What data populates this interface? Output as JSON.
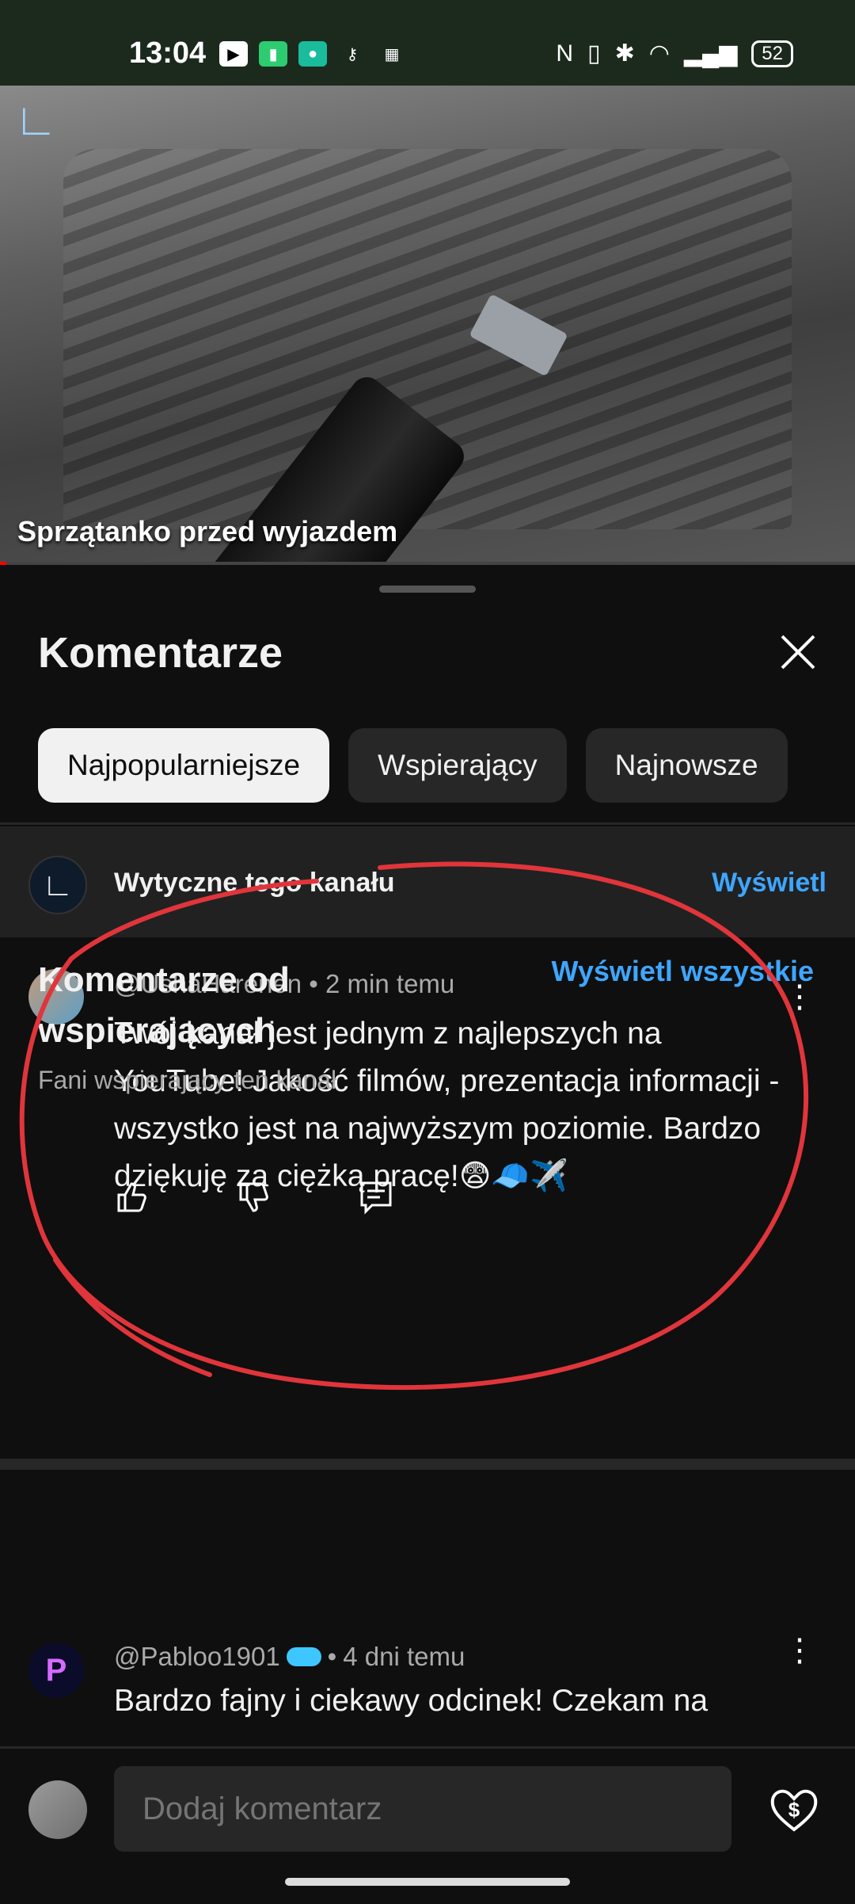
{
  "status_bar": {
    "time": "13:04",
    "battery": "52",
    "icons": [
      "youtube-icon",
      "battery-saver-icon",
      "chat-icon",
      "keyhole-icon",
      "calendar-icon",
      "nfc-icon",
      "vibrate-icon",
      "bluetooth-icon",
      "wifi-icon",
      "signal-icon"
    ]
  },
  "video": {
    "title": "Sprzątanko przed wyjazdem"
  },
  "sheet": {
    "title": "Komentarze",
    "chips": [
      {
        "label": "Najpopularniejsze",
        "active": true
      },
      {
        "label": "Wspierający",
        "active": false
      },
      {
        "label": "Najnowsze",
        "active": false
      }
    ]
  },
  "guidelines": {
    "text": "Wytyczne tego kanału",
    "link": "Wyświetl"
  },
  "comments": [
    {
      "author": "@UshaHarenen",
      "time": "2 min temu",
      "text": "Twój kanał jest jednym z najlepszych na YouTube! Jakość filmów, prezentacja informacji - wszystko jest na najwyższym poziomie. Bardzo dziękuję za ciężką pracę!😨🧢✈️"
    }
  ],
  "supporters": {
    "title": "Komentarze od wspierających",
    "link": "Wyświetl wszystkie",
    "subtitle": "Fani wspierający ten kanał",
    "comment": {
      "author": "@Pabloo1901",
      "time": "4 dni temu",
      "text": "Bardzo fajny i ciekawy odcinek! Czekam na"
    }
  },
  "composer": {
    "placeholder": "Dodaj komentarz"
  },
  "colors": {
    "accent_link": "#3ea6ff",
    "annotation": "#e0353b"
  }
}
